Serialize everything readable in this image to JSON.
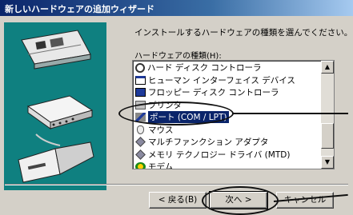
{
  "window": {
    "title": "新しいハードウェアの追加ウィザード"
  },
  "instruction": "インストールするハードウェアの種類を選んでください。",
  "hardware_list": {
    "label": "ハードウェアの種類(H):",
    "items": [
      {
        "label": "ハード ディスク コントローラ",
        "icon": "hdd-controller-icon"
      },
      {
        "label": "ヒューマン インターフェイス デバイス",
        "icon": "human-interface-icon"
      },
      {
        "label": "フロッピー ディスク コントローラ",
        "icon": "floppy-controller-icon"
      },
      {
        "label": "プリンタ",
        "icon": "printer-icon"
      },
      {
        "label": "ポート (COM / LPT)",
        "icon": "port-icon",
        "selected": true
      },
      {
        "label": "マウス",
        "icon": "mouse-icon"
      },
      {
        "label": "マルチファンクション アダプタ",
        "icon": "multifunction-adapter-icon"
      },
      {
        "label": "メモリ テクノロジー ドライバ (MTD)",
        "icon": "memory-driver-icon"
      },
      {
        "label": "モデム",
        "icon": "modem-icon"
      }
    ]
  },
  "buttons": {
    "back": "< 戻る(B)",
    "next": "次へ >",
    "cancel": "キャンセル"
  },
  "colors": {
    "title_bar": "#0a246a",
    "art_panel": "#0f8080",
    "selection": "#0a246a",
    "dialog_bg": "#d4d0c8"
  }
}
